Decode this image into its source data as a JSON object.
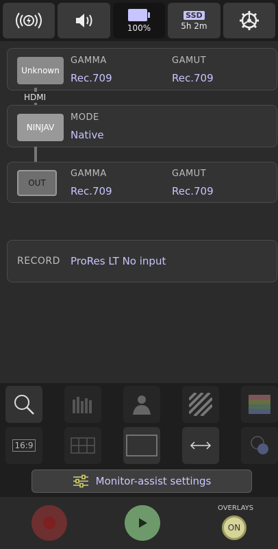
{
  "topbar": {
    "battery_percent": "100%",
    "ssd_label": "SSD",
    "ssd_remaining": "5h 2m"
  },
  "input_card": {
    "source_label": "Unknown",
    "gamma_label": "GAMMA",
    "gamma_value": "Rec.709",
    "gamut_label": "GAMUT",
    "gamut_value": "Rec.709"
  },
  "connection_label": "HDMI",
  "ninja_card": {
    "device_label": "NINJAV",
    "mode_label": "MODE",
    "mode_value": "Native"
  },
  "output_card": {
    "out_label": "OUT",
    "gamma_label": "GAMMA",
    "gamma_value": "Rec.709",
    "gamut_label": "GAMUT",
    "gamut_value": "Rec.709"
  },
  "record_card": {
    "label": "RECORD",
    "value": "ProRes LT No input"
  },
  "tools": {
    "aspect_label": "16:9",
    "monitor_assist_label": "Monitor-assist settings"
  },
  "bottom": {
    "overlays_label": "OVERLAYS",
    "overlays_state": "ON"
  },
  "colors": {
    "accent_value": "#c7c4ff",
    "record": "#6d2f2f",
    "play": "#6e9a6b",
    "overlay_on": "#d7d49a"
  }
}
